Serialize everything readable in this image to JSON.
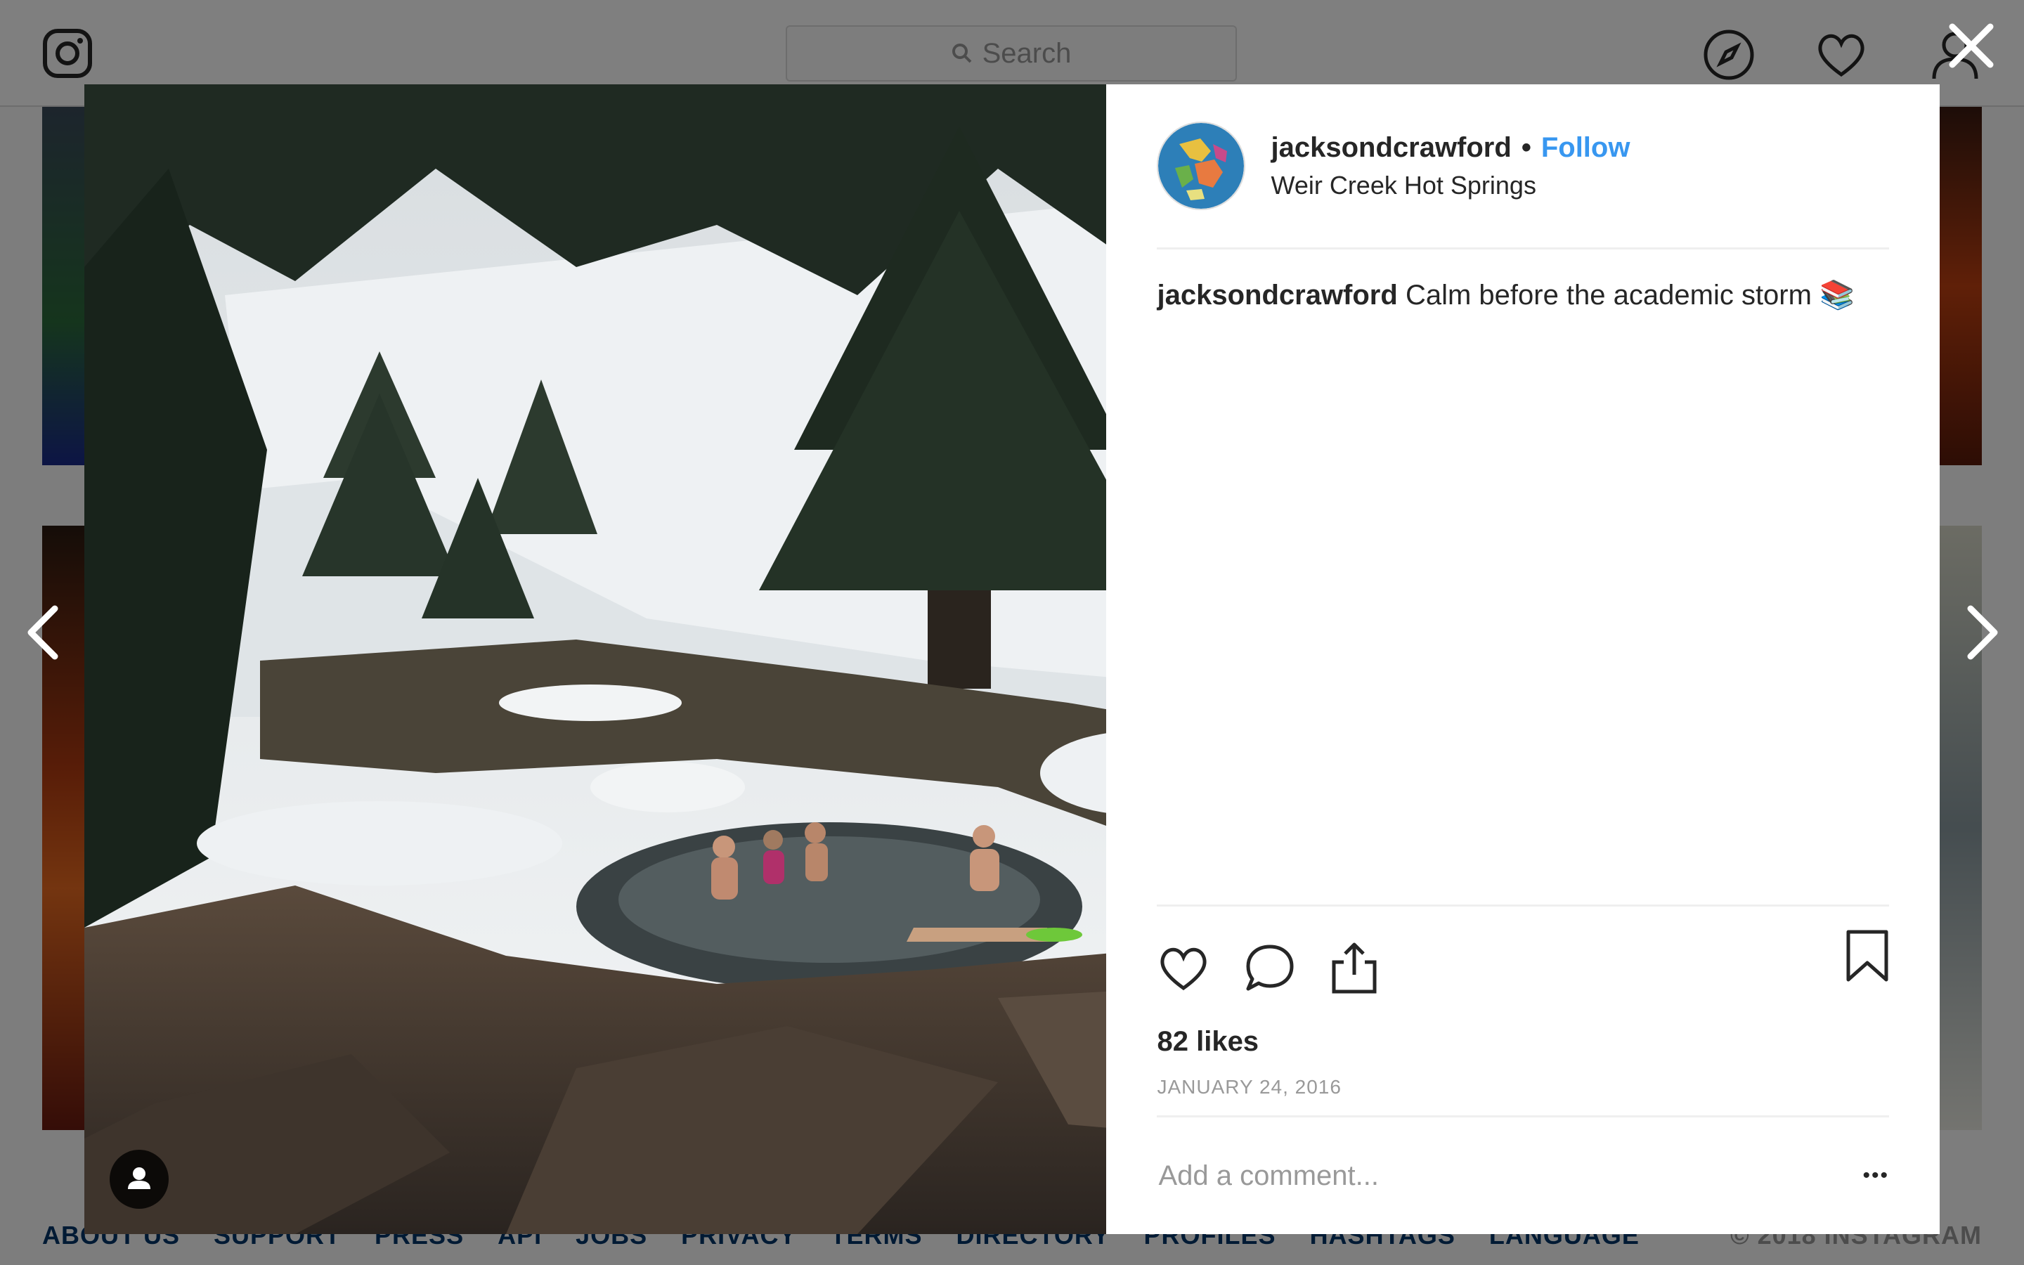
{
  "nav": {
    "logo_icon": "instagram-icon",
    "search_placeholder": "Search",
    "icons": [
      "compass-icon",
      "heart-icon",
      "user-icon"
    ]
  },
  "footer": {
    "links": [
      "ABOUT US",
      "SUPPORT",
      "PRESS",
      "API",
      "JOBS",
      "PRIVACY",
      "TERMS",
      "DIRECTORY",
      "PROFILES",
      "HASHTAGS",
      "LANGUAGE"
    ],
    "copyright": "© 2018 INSTAGRAM"
  },
  "post": {
    "username": "jacksondcrawford",
    "follow_label": "Follow",
    "separator": "•",
    "location": "Weir Creek Hot Springs",
    "caption_user": "jacksondcrawford",
    "caption_text": "Calm before the academic storm 📚",
    "likes": "82 likes",
    "date": "JANUARY 24, 2016",
    "comment_placeholder": "Add a comment...",
    "more_label": "•••"
  },
  "colors": {
    "accent": "#3897f0",
    "text": "#262626",
    "muted": "#999999"
  }
}
